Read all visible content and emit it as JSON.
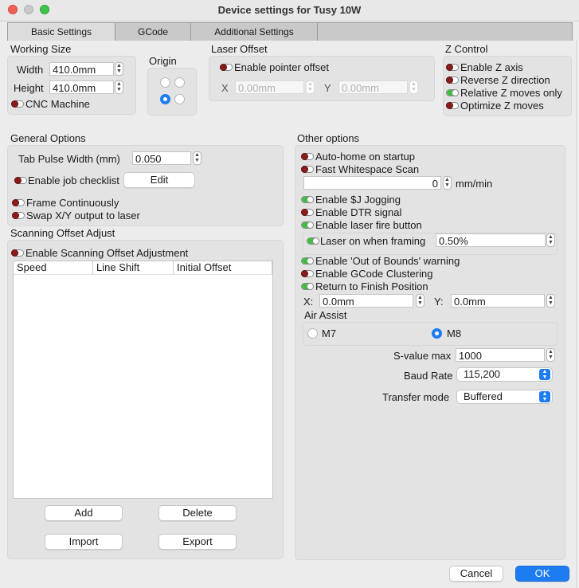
{
  "window": {
    "title": "Device settings for Tusy 10W"
  },
  "tabs": [
    {
      "label": "Basic Settings",
      "active": true
    },
    {
      "label": "GCode",
      "active": false
    },
    {
      "label": "Additional Settings",
      "active": false
    }
  ],
  "working_size": {
    "heading": "Working Size",
    "width_label": "Width",
    "width_value": "410.0mm",
    "height_label": "Height",
    "height_value": "410.0mm",
    "cnc_label": "CNC Machine"
  },
  "origin": {
    "heading": "Origin",
    "selected": "bottom-left"
  },
  "laser_offset": {
    "heading": "Laser Offset",
    "enable_label": "Enable pointer offset",
    "x_label": "X",
    "x_value": "0.00mm",
    "y_label": "Y",
    "y_value": "0.00mm"
  },
  "z_control": {
    "heading": "Z Control",
    "items": [
      {
        "label": "Enable Z axis",
        "on": false
      },
      {
        "label": "Reverse Z direction",
        "on": false
      },
      {
        "label": "Relative Z moves only",
        "on": true
      },
      {
        "label": "Optimize Z moves",
        "on": false
      }
    ]
  },
  "general": {
    "heading": "General Options",
    "tab_pulse_label": "Tab Pulse Width (mm)",
    "tab_pulse_value": "0.050",
    "job_checklist_label": "Enable job checklist",
    "edit_label": "Edit",
    "frame_continuously_label": "Frame Continuously",
    "swap_xy_label": "Swap X/Y output to laser"
  },
  "scanning": {
    "heading": "Scanning Offset Adjust",
    "enable_label": "Enable Scanning Offset Adjustment",
    "columns": [
      "Speed",
      "Line Shift",
      "Initial Offset"
    ],
    "add_label": "Add",
    "delete_label": "Delete",
    "import_label": "Import",
    "export_label": "Export"
  },
  "other": {
    "heading": "Other options",
    "auto_home_label": "Auto-home on startup",
    "fast_ws_label": "Fast Whitespace Scan",
    "fast_ws_value": "0",
    "fast_ws_unit": "mm/min",
    "jog_label": "Enable $J Jogging",
    "dtr_label": "Enable DTR signal",
    "fire_label": "Enable laser fire button",
    "framing_label": "Laser on when framing",
    "framing_value": "0.50%",
    "oob_label": "Enable 'Out of Bounds' warning",
    "clustering_label": "Enable GCode Clustering",
    "return_label": "Return to Finish Position",
    "x_label": "X:",
    "x_value": "0.0mm",
    "y_label": "Y:",
    "y_value": "0.0mm",
    "air_assist_heading": "Air Assist",
    "m7_label": "M7",
    "m8_label": "M8",
    "air_selected": "M8",
    "svalue_label": "S-value max",
    "svalue_value": "1000",
    "baud_label": "Baud Rate",
    "baud_value": "115,200",
    "transfer_label": "Transfer mode",
    "transfer_value": "Buffered"
  },
  "footer": {
    "cancel_label": "Cancel",
    "ok_label": "OK"
  },
  "colors": {
    "accent": "#1e7cf2",
    "toggle_off": "#8b1c1c",
    "toggle_on": "#3fbf3f"
  }
}
